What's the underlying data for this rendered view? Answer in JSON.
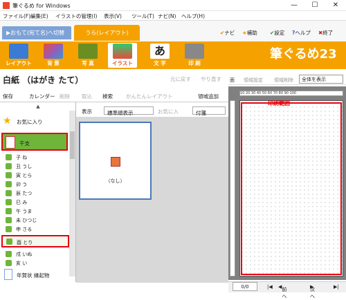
{
  "window": {
    "title": "筆ぐるめ for Windows",
    "minimize": "—",
    "maximize": "☐",
    "close": "✕"
  },
  "menu": [
    "ファイル(F)",
    "編集(E)",
    "イラストの管理(I)",
    "表示(V)",
    "ツール(T)",
    "ナビ(N)",
    "ヘルプ(H)"
  ],
  "tabs": {
    "omote": "▶おもて(宛て名)へ切替",
    "ura": "うら(レイアウト)"
  },
  "links": {
    "navi": "ナビ",
    "hojo": "補助",
    "settei": "設定",
    "help": "ヘルプ",
    "exit": "終了"
  },
  "ribbon": [
    {
      "label": "レイアウト",
      "icon": "layout-icon",
      "color": "#3a7bd5"
    },
    {
      "label": "背 景",
      "icon": "background-icon",
      "color": "#9b59b6"
    },
    {
      "label": "写 真",
      "icon": "photo-icon",
      "color": "#6b8e23"
    },
    {
      "label": "イラスト",
      "icon": "illust-icon",
      "color": "#d94a2b"
    },
    {
      "label": "文 字",
      "icon": "text-icon",
      "color": "#333333"
    },
    {
      "label": "印 刷",
      "icon": "printer-icon",
      "color": "#888888"
    }
  ],
  "brand": "筆ぐるめ23",
  "card": {
    "title": "白紙 （はがき たて）",
    "undo": "元に戻す",
    "redo": "やり直す"
  },
  "toolbar": {
    "save": "保存",
    "calendar": "カレンダー",
    "delete": "削除",
    "import": "取込",
    "search": "検索",
    "easy_layout": "かんたんレイアウト",
    "add_area": "領域追加"
  },
  "tree": {
    "favorites": "お気に入り",
    "eto": "干支",
    "items": [
      "子 ね",
      "丑 うし",
      "寅 とら",
      "卯 う",
      "辰 たつ",
      "巳 み",
      "午 うま",
      "未 ひつじ",
      "申 さる",
      "酉 とり",
      "戌 いぬ",
      "亥 い"
    ],
    "nenga": "年賀状 縁起物"
  },
  "view": {
    "label": "表示",
    "order": "標準順表示",
    "favorite": "お気に入",
    "fusen": "付箋"
  },
  "thumbnail": {
    "caption": "（なし）"
  },
  "right": {
    "men": "面",
    "area_settings": "領域設定",
    "area_delete": "領域削除",
    "zoom": "全体を表示",
    "print_range": "印刷範囲",
    "ruler": "10 20 30 40 50 60 70 80 90 100"
  },
  "bottom": {
    "page": "0/0",
    "prev": "前へ",
    "next": "次へ"
  }
}
